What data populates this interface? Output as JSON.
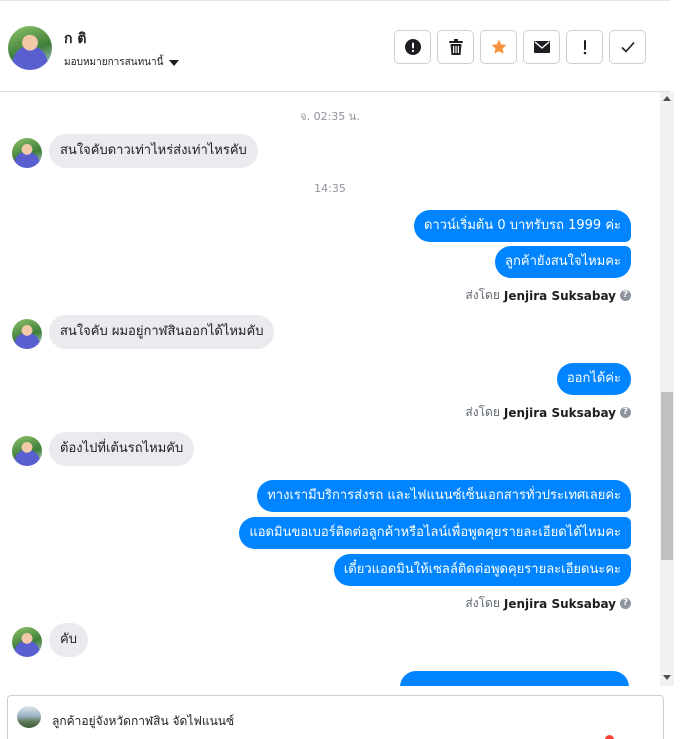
{
  "header": {
    "contact_name": "ก ติ",
    "assign_label": "มอบหมายการสนทนานี้"
  },
  "actions": [
    {
      "name": "mark-spam-button",
      "icon": "alert-circle-icon"
    },
    {
      "name": "delete-button",
      "icon": "trash-icon"
    },
    {
      "name": "star-button",
      "icon": "star-icon"
    },
    {
      "name": "mark-unread-button",
      "icon": "envelope-icon"
    },
    {
      "name": "follow-up-button",
      "icon": "exclamation-icon"
    },
    {
      "name": "mark-done-button",
      "icon": "check-icon"
    }
  ],
  "colors": {
    "accent": "#0084ff",
    "incoming_bubble": "#e9ebee",
    "star": "#f7923b"
  },
  "thread": {
    "timestamp_1": "จ. 02:35 น.",
    "timestamp_2": "14:35",
    "messages": [
      {
        "direction": "in",
        "text": "สนใจคับดาวเท่าไหร่ส่งเท่าไหรคับ"
      },
      {
        "direction": "out",
        "text": "ดาวน์เริ่มต้น 0 บาทรับรถ 1999 ค่ะ"
      },
      {
        "direction": "out",
        "text": "ลูกค้ายังสนใจไหมคะ"
      },
      {
        "direction": "in",
        "text": "สนใจคับ ผมอยู่กาฬสินออกได้ไหมคับ"
      },
      {
        "direction": "out",
        "text": "ออกได้ค่ะ"
      },
      {
        "direction": "in",
        "text": "ต้องไปที่เต้นรถไหมคับ"
      },
      {
        "direction": "out",
        "text": "ทางเรามีบริการส่งรถ และไฟแนนซ์เซ็นเอกสารทั่วประเทศเลยค่ะ"
      },
      {
        "direction": "out",
        "text": "แอดมินขอเบอร์ติดต่อลูกค้าหรือไลน์เพื่อพูดคุยรายละเอียดได้ไหมคะ"
      },
      {
        "direction": "out",
        "text": "เดี๋ยวแอดมินให้เซลล์ติดต่อพูดคุยรายละเอียดนะคะ"
      },
      {
        "direction": "in",
        "text": "คับ"
      }
    ],
    "sent_by_prefix": "ส่งโดย",
    "sent_by_agent": "Jenjira Suksabay"
  },
  "composer": {
    "preview_text": "ลูกค้าอยู่จังหวัดกาฬสิน จัดไฟแนนซ์"
  }
}
